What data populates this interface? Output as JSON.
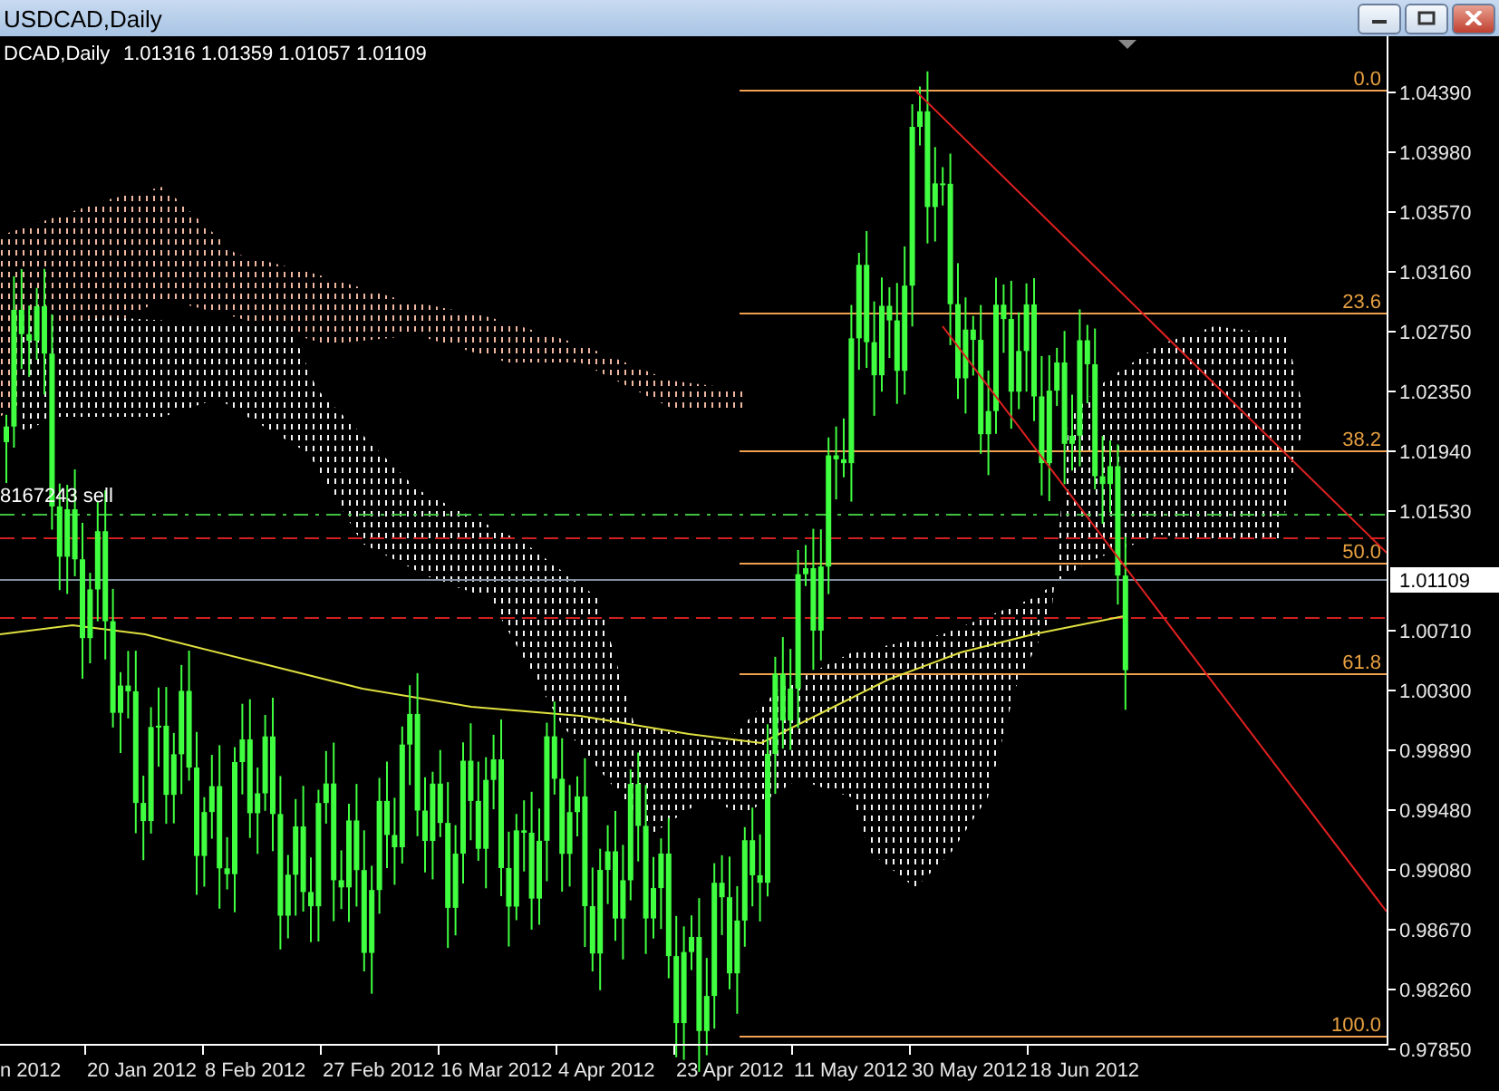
{
  "window": {
    "title": "USDCAD,Daily"
  },
  "chart": {
    "symbol": "DCAD,Daily",
    "ohlc": "1.01316 1.01359 1.01057 1.01109",
    "order_label": "8167243 sell",
    "price_axis": [
      "1.04390",
      "1.03980",
      "1.03570",
      "1.03160",
      "1.02750",
      "1.02350",
      "1.01940",
      "1.01530",
      "1.00710",
      "1.00300",
      "0.99890",
      "0.99480",
      "0.99080",
      "0.98670",
      "0.98260",
      "0.97850"
    ],
    "current_price": "1.01109",
    "time_axis": [
      "n 2012",
      "20 Jan 2012",
      "8 Feb 2012",
      "27 Feb 2012",
      "16 Mar 2012",
      "4 Apr 2012",
      "23 Apr 2012",
      "11 May 2012",
      "30 May 2012",
      "18 Jun 2012"
    ],
    "fibonacci_levels": [
      "0.0",
      "23.6",
      "38.2",
      "50.0",
      "61.8",
      "100.0"
    ]
  }
}
